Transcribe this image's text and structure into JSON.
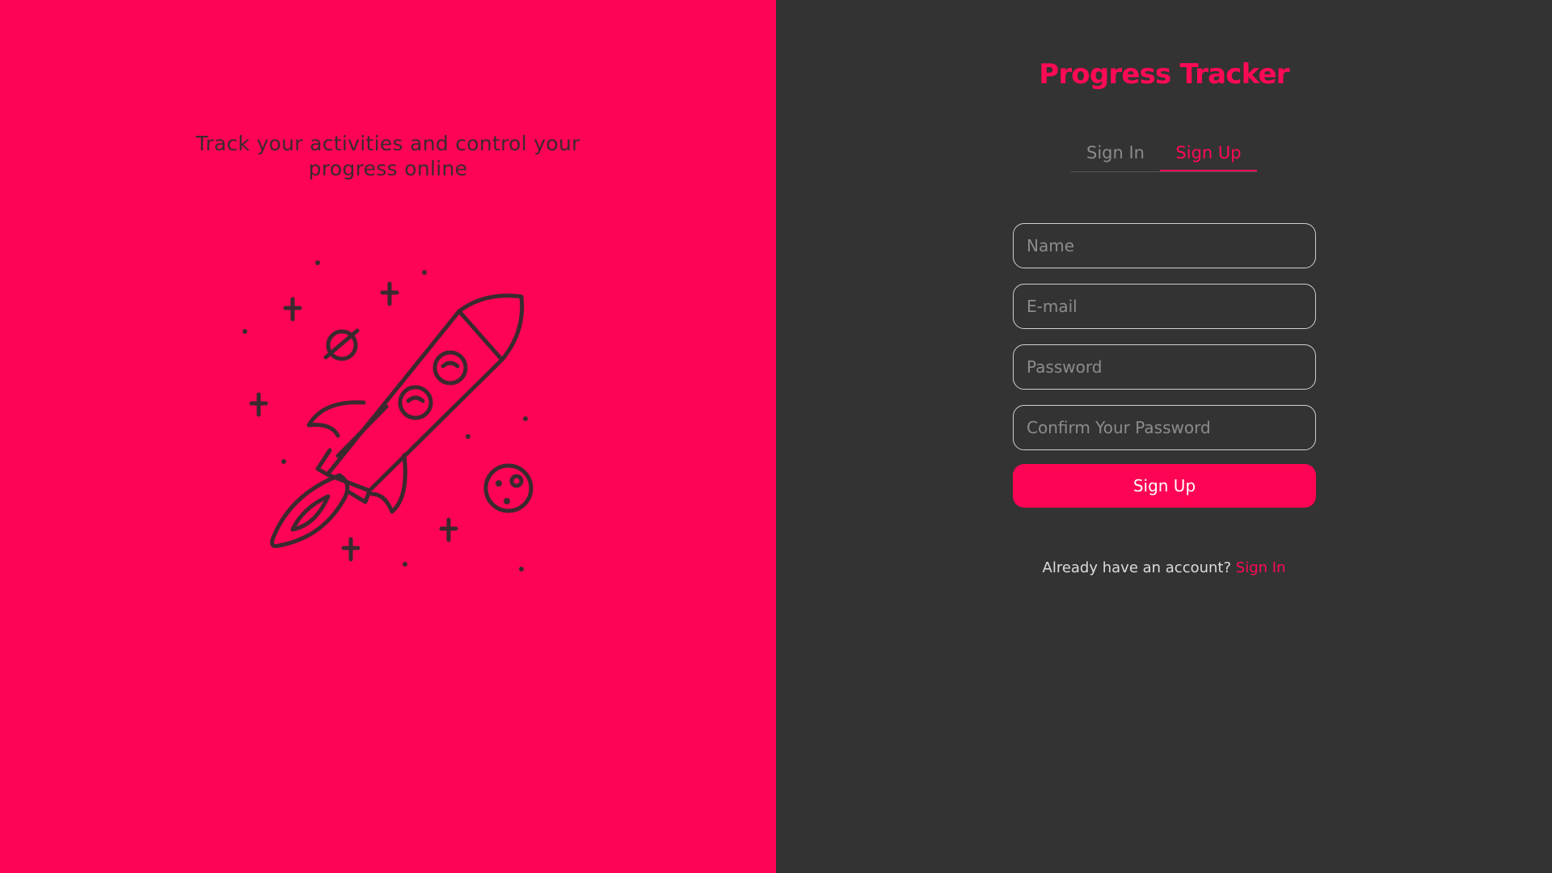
{
  "hero": {
    "tagline_line1": "Track your activities and control your",
    "tagline_line2": "progress online",
    "illustration_icon": "rocket-launch-icon"
  },
  "app": {
    "title": "Progress Tracker"
  },
  "tabs": [
    {
      "label": "Sign In",
      "active": false
    },
    {
      "label": "Sign Up",
      "active": true
    }
  ],
  "form": {
    "name_placeholder": "Name",
    "name_value": "",
    "email_placeholder": "E-mail",
    "email_value": "",
    "password_placeholder": "Password",
    "password_value": "",
    "confirm_placeholder": "Confirm Your Password",
    "confirm_value": "",
    "submit_label": "Sign Up"
  },
  "footer": {
    "prompt": "Already have an account?",
    "link_label": "Sign In"
  },
  "colors": {
    "accent": "#ff0454",
    "panel_dark": "#333333",
    "illustration_stroke": "#3a2a30"
  }
}
